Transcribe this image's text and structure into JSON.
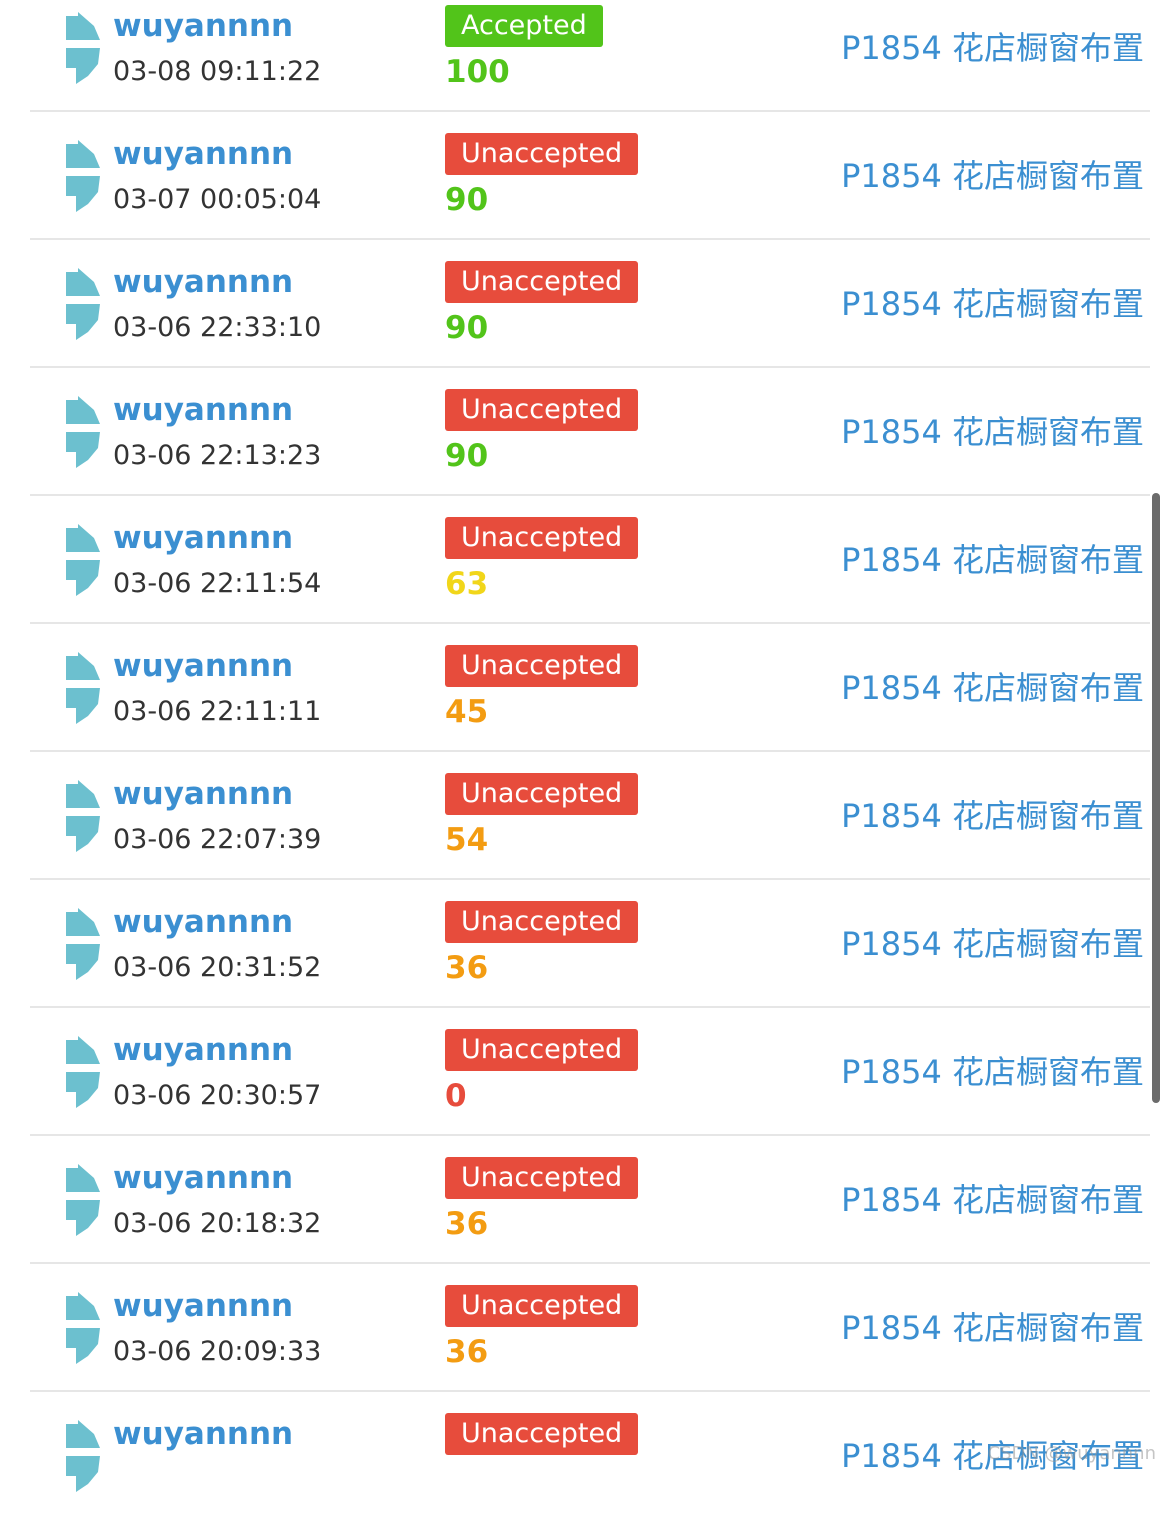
{
  "records": [
    {
      "user": "wuyannnn",
      "time": "03-08 09:11:22",
      "status": "Accepted",
      "accepted": true,
      "score": "100",
      "score_color": "#52c41a",
      "problem": "P1854 花店橱窗布置"
    },
    {
      "user": "wuyannnn",
      "time": "03-07 00:05:04",
      "status": "Unaccepted",
      "accepted": false,
      "score": "90",
      "score_color": "#52c41a",
      "problem": "P1854 花店橱窗布置"
    },
    {
      "user": "wuyannnn",
      "time": "03-06 22:33:10",
      "status": "Unaccepted",
      "accepted": false,
      "score": "90",
      "score_color": "#52c41a",
      "problem": "P1854 花店橱窗布置"
    },
    {
      "user": "wuyannnn",
      "time": "03-06 22:13:23",
      "status": "Unaccepted",
      "accepted": false,
      "score": "90",
      "score_color": "#52c41a",
      "problem": "P1854 花店橱窗布置"
    },
    {
      "user": "wuyannnn",
      "time": "03-06 22:11:54",
      "status": "Unaccepted",
      "accepted": false,
      "score": "63",
      "score_color": "#f1d61a",
      "problem": "P1854 花店橱窗布置"
    },
    {
      "user": "wuyannnn",
      "time": "03-06 22:11:11",
      "status": "Unaccepted",
      "accepted": false,
      "score": "45",
      "score_color": "#f39c12",
      "problem": "P1854 花店橱窗布置"
    },
    {
      "user": "wuyannnn",
      "time": "03-06 22:07:39",
      "status": "Unaccepted",
      "accepted": false,
      "score": "54",
      "score_color": "#f39c12",
      "problem": "P1854 花店橱窗布置"
    },
    {
      "user": "wuyannnn",
      "time": "03-06 20:31:52",
      "status": "Unaccepted",
      "accepted": false,
      "score": "36",
      "score_color": "#f39c12",
      "problem": "P1854 花店橱窗布置"
    },
    {
      "user": "wuyannnn",
      "time": "03-06 20:30:57",
      "status": "Unaccepted",
      "accepted": false,
      "score": "0",
      "score_color": "#e74c3c",
      "problem": "P1854 花店橱窗布置"
    },
    {
      "user": "wuyannnn",
      "time": "03-06 20:18:32",
      "status": "Unaccepted",
      "accepted": false,
      "score": "36",
      "score_color": "#f39c12",
      "problem": "P1854 花店橱窗布置"
    },
    {
      "user": "wuyannnn",
      "time": "03-06 20:09:33",
      "status": "Unaccepted",
      "accepted": false,
      "score": "36",
      "score_color": "#f39c12",
      "problem": "P1854 花店橱窗布置"
    },
    {
      "user": "wuyannnn",
      "time": "",
      "status": "Unaccepted",
      "accepted": false,
      "score": "",
      "score_color": "#e74c3c",
      "problem": "P1854 花店橱窗布置"
    }
  ],
  "colors": {
    "link": "#3b8fd1",
    "accepted_bg": "#52c41a",
    "unaccepted_bg": "#e74c3c",
    "avatar": "#6cc0cf"
  },
  "watermark": "CSDN @wuyannnn"
}
